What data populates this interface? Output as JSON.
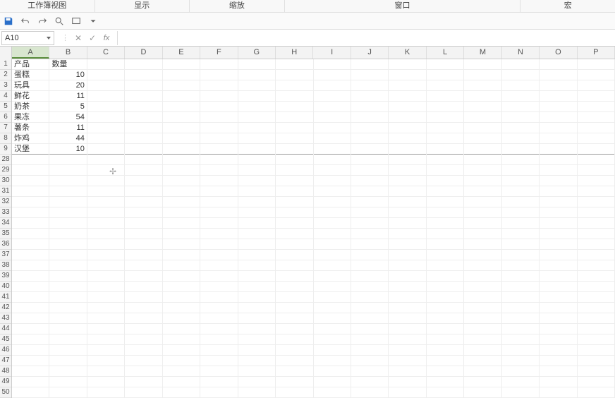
{
  "menubar": {
    "items": [
      "工作簿视图",
      "显示",
      "缩放",
      "窗口",
      "宏"
    ]
  },
  "namebox": {
    "value": "A10"
  },
  "columns": [
    "A",
    "B",
    "C",
    "D",
    "E",
    "F",
    "G",
    "H",
    "I",
    "J",
    "K",
    "L",
    "M",
    "N",
    "O",
    "P"
  ],
  "row_labels_top": [
    "1",
    "2",
    "3",
    "4",
    "5",
    "6",
    "7",
    "8",
    "9"
  ],
  "row_labels_bottom": [
    "28",
    "29",
    "30",
    "31",
    "32",
    "33",
    "34",
    "35",
    "36",
    "37",
    "38",
    "39",
    "40",
    "41",
    "42",
    "43",
    "44",
    "45",
    "46",
    "47",
    "48",
    "49",
    "50"
  ],
  "sheet": {
    "headerA": "产品",
    "headerB": "数量",
    "rows": [
      {
        "a": "蛋糕",
        "b": "10"
      },
      {
        "a": "玩具",
        "b": "20"
      },
      {
        "a": "鲜花",
        "b": "11"
      },
      {
        "a": "奶茶",
        "b": "5"
      },
      {
        "a": "果冻",
        "b": "54"
      },
      {
        "a": "薯条",
        "b": "11"
      },
      {
        "a": "炸鸡",
        "b": "44"
      },
      {
        "a": "汉堡",
        "b": "10"
      }
    ]
  },
  "chart_data": {
    "type": "table",
    "title": "",
    "columns": [
      "产品",
      "数量"
    ],
    "rows": [
      [
        "蛋糕",
        10
      ],
      [
        "玩具",
        20
      ],
      [
        "鲜花",
        11
      ],
      [
        "奶茶",
        5
      ],
      [
        "果冻",
        54
      ],
      [
        "薯条",
        11
      ],
      [
        "炸鸡",
        44
      ],
      [
        "汉堡",
        10
      ]
    ]
  }
}
